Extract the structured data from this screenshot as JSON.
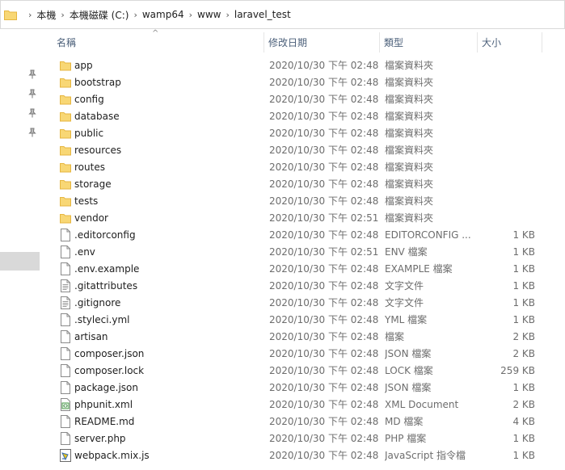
{
  "breadcrumb": [
    "本機",
    "本機磁碟 (C:)",
    "wamp64",
    "www",
    "laravel_test"
  ],
  "columns": {
    "name": "名稱",
    "date": "修改日期",
    "type": "類型",
    "size": "大小"
  },
  "colors": {
    "folder": "#f8d775",
    "folder_dark": "#e6b640",
    "header_text": "#4c607a",
    "detail_text": "#6d6d6d"
  },
  "files": [
    {
      "name": "app",
      "date": "2020/10/30 下午 02:48",
      "type": "檔案資料夾",
      "size": "",
      "icon": "folder-icon"
    },
    {
      "name": "bootstrap",
      "date": "2020/10/30 下午 02:48",
      "type": "檔案資料夾",
      "size": "",
      "icon": "folder-icon"
    },
    {
      "name": "config",
      "date": "2020/10/30 下午 02:48",
      "type": "檔案資料夾",
      "size": "",
      "icon": "folder-icon"
    },
    {
      "name": "database",
      "date": "2020/10/30 下午 02:48",
      "type": "檔案資料夾",
      "size": "",
      "icon": "folder-icon"
    },
    {
      "name": "public",
      "date": "2020/10/30 下午 02:48",
      "type": "檔案資料夾",
      "size": "",
      "icon": "folder-icon"
    },
    {
      "name": "resources",
      "date": "2020/10/30 下午 02:48",
      "type": "檔案資料夾",
      "size": "",
      "icon": "folder-icon"
    },
    {
      "name": "routes",
      "date": "2020/10/30 下午 02:48",
      "type": "檔案資料夾",
      "size": "",
      "icon": "folder-icon"
    },
    {
      "name": "storage",
      "date": "2020/10/30 下午 02:48",
      "type": "檔案資料夾",
      "size": "",
      "icon": "folder-icon"
    },
    {
      "name": "tests",
      "date": "2020/10/30 下午 02:48",
      "type": "檔案資料夾",
      "size": "",
      "icon": "folder-icon"
    },
    {
      "name": "vendor",
      "date": "2020/10/30 下午 02:51",
      "type": "檔案資料夾",
      "size": "",
      "icon": "folder-icon"
    },
    {
      "name": ".editorconfig",
      "date": "2020/10/30 下午 02:48",
      "type": "EDITORCONFIG ...",
      "size": "1 KB",
      "icon": "file-icon"
    },
    {
      "name": ".env",
      "date": "2020/10/30 下午 02:51",
      "type": "ENV 檔案",
      "size": "1 KB",
      "icon": "file-icon"
    },
    {
      "name": ".env.example",
      "date": "2020/10/30 下午 02:48",
      "type": "EXAMPLE 檔案",
      "size": "1 KB",
      "icon": "file-icon"
    },
    {
      "name": ".gitattributes",
      "date": "2020/10/30 下午 02:48",
      "type": "文字文件",
      "size": "1 KB",
      "icon": "text-file-icon"
    },
    {
      "name": ".gitignore",
      "date": "2020/10/30 下午 02:48",
      "type": "文字文件",
      "size": "1 KB",
      "icon": "text-file-icon"
    },
    {
      "name": ".styleci.yml",
      "date": "2020/10/30 下午 02:48",
      "type": "YML 檔案",
      "size": "1 KB",
      "icon": "file-icon"
    },
    {
      "name": "artisan",
      "date": "2020/10/30 下午 02:48",
      "type": "檔案",
      "size": "2 KB",
      "icon": "file-icon"
    },
    {
      "name": "composer.json",
      "date": "2020/10/30 下午 02:48",
      "type": "JSON 檔案",
      "size": "2 KB",
      "icon": "file-icon"
    },
    {
      "name": "composer.lock",
      "date": "2020/10/30 下午 02:48",
      "type": "LOCK 檔案",
      "size": "259 KB",
      "icon": "file-icon"
    },
    {
      "name": "package.json",
      "date": "2020/10/30 下午 02:48",
      "type": "JSON 檔案",
      "size": "1 KB",
      "icon": "file-icon"
    },
    {
      "name": "phpunit.xml",
      "date": "2020/10/30 下午 02:48",
      "type": "XML Document",
      "size": "2 KB",
      "icon": "xml-file-icon"
    },
    {
      "name": "README.md",
      "date": "2020/10/30 下午 02:48",
      "type": "MD 檔案",
      "size": "4 KB",
      "icon": "file-icon"
    },
    {
      "name": "server.php",
      "date": "2020/10/30 下午 02:48",
      "type": "PHP 檔案",
      "size": "1 KB",
      "icon": "file-icon"
    },
    {
      "name": "webpack.mix.js",
      "date": "2020/10/30 下午 02:48",
      "type": "JavaScript 指令檔",
      "size": "1 KB",
      "icon": "js-file-icon"
    }
  ]
}
